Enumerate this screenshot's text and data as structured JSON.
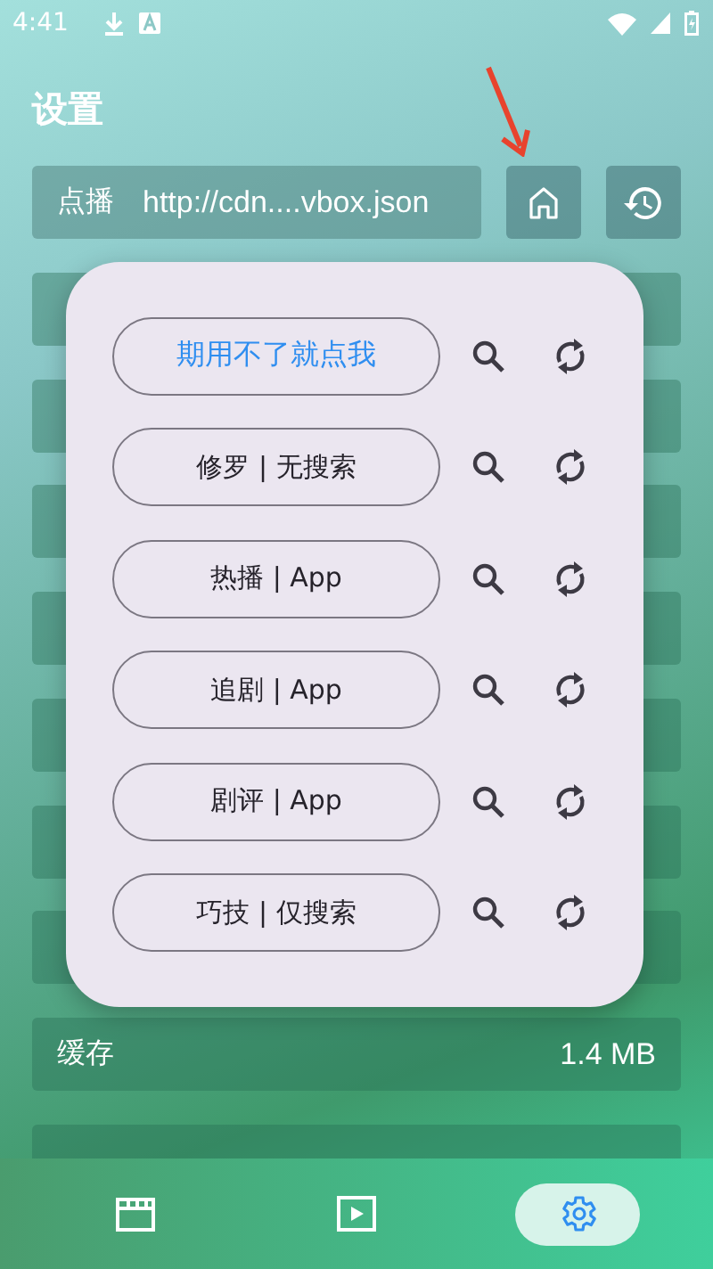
{
  "status_bar": {
    "time": "4:41"
  },
  "title": "设置",
  "source": {
    "label": "点播",
    "value": "http://cdn....vbox.json"
  },
  "settings": [
    {
      "label": "缓存",
      "value": "1.4 MB"
    }
  ],
  "sites": [
    {
      "name": "期用不了就点我",
      "selected": true
    },
    {
      "name": "修罗 | 无搜索",
      "selected": false
    },
    {
      "name": "热播 | App",
      "selected": false
    },
    {
      "name": "追剧 | App",
      "selected": false
    },
    {
      "name": "剧评 | App",
      "selected": false
    },
    {
      "name": "巧技 | 仅搜索",
      "selected": false
    }
  ],
  "nav": [
    {
      "kind": "clapper",
      "selected": false
    },
    {
      "kind": "play",
      "selected": false
    },
    {
      "kind": "gear",
      "selected": true
    }
  ]
}
